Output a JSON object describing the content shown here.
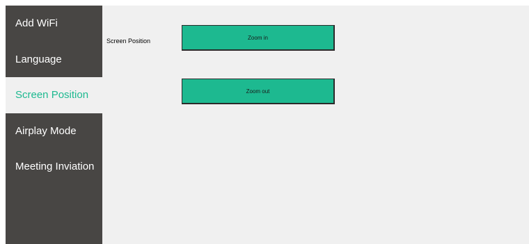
{
  "colors": {
    "sidebar_bg": "#484644",
    "content_bg": "#f0f0f0",
    "accent": "#1db990",
    "sidebar_text": "#ffffff"
  },
  "sidebar": {
    "items": [
      {
        "label": "Add WiFi",
        "active": false
      },
      {
        "label": "Language",
        "active": false
      },
      {
        "label": "Screen Position",
        "active": true
      },
      {
        "label": "Airplay Mode",
        "active": false
      },
      {
        "label": "Meeting Inviation",
        "active": false
      }
    ]
  },
  "main": {
    "section_label": "Screen Position",
    "zoom_in_label": "Zoom in",
    "zoom_out_label": "Zoom out"
  }
}
